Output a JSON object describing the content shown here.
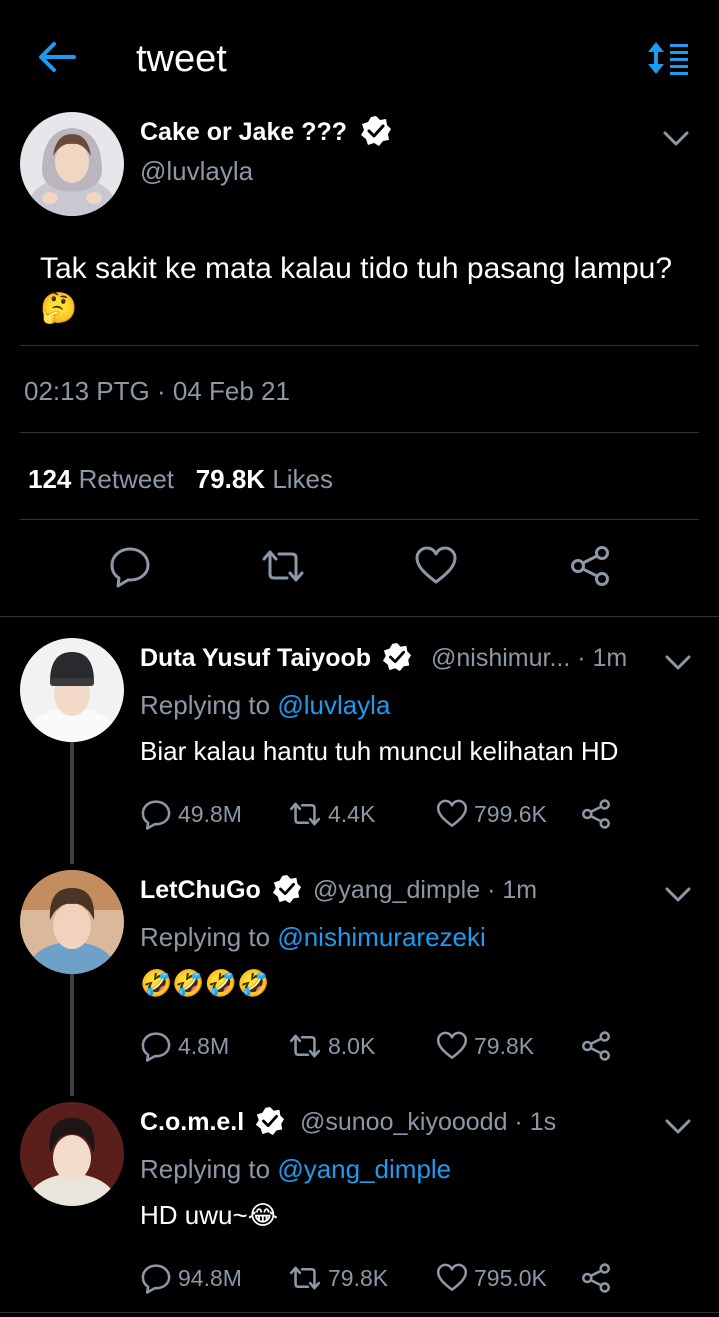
{
  "header": {
    "title": "tweet",
    "back_icon": "back-arrow-icon",
    "sort_icon": "sort-icon"
  },
  "main_tweet": {
    "display_name": "Cake or Jake ???",
    "handle": "@luvlayla",
    "text": "Tak sakit ke mata kalau tido tuh pasang lampu?",
    "emoji": "🤔",
    "timestamp": "02:13 PTG · 04 Feb 21",
    "retweets": "124",
    "retweets_label": "Retweet",
    "likes": "79.8K",
    "likes_label": "Likes"
  },
  "replies": [
    {
      "display_name": "Duta Yusuf Taiyoob",
      "handle_time": "@nishimur... · 1m",
      "replying_prefix": "Replying to",
      "replying_to": "@luvlayla",
      "text": "Biar kalau hantu tuh muncul kelihatan HD",
      "replies": "49.8M",
      "retweets": "4.4K",
      "likes": "799.6K"
    },
    {
      "display_name": "LetChuGo",
      "handle_time": "@yang_dimple · 1m",
      "replying_prefix": "Replying to",
      "replying_to": "@nishimurarezeki",
      "text": "🤣🤣🤣🤣",
      "replies": "4.8M",
      "retweets": "8.0K",
      "likes": "79.8K"
    },
    {
      "display_name": "C.o.m.e.l",
      "handle_time": "@sunoo_kiyooodd · 1s",
      "replying_prefix": "Replying to",
      "replying_to": "@yang_dimple",
      "text": "HD uwu~",
      "emoji": "😂",
      "replies": "94.8M",
      "retweets": "79.8K",
      "likes": "795.0K"
    }
  ],
  "colors": {
    "background": "#000000",
    "accent": "#1d9bf0",
    "muted": "#8b98a5",
    "divider": "#2f3336"
  }
}
